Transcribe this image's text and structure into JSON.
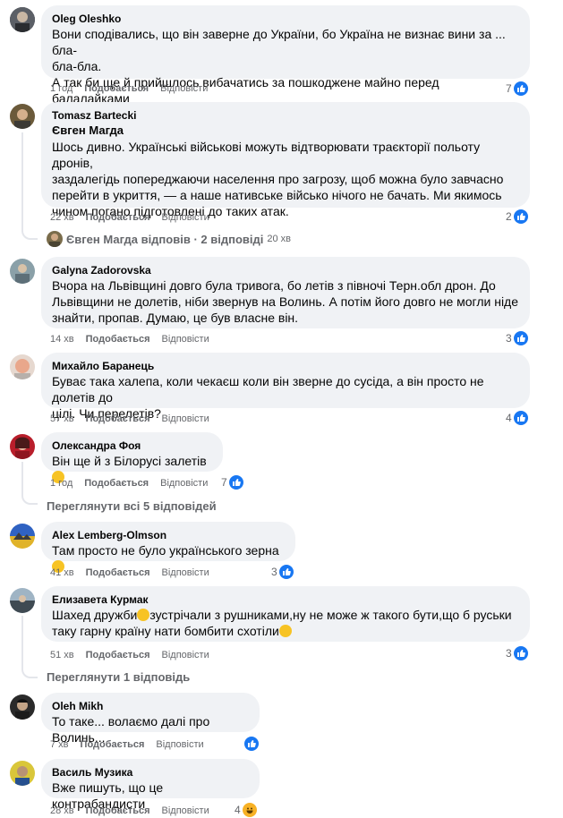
{
  "comments": [
    {
      "author": "Oleg Oleshko",
      "lines": [
        "Вони сподівались, що він заверне до України, бо Україна не визнає вини за ... бла-",
        "бла-бла.",
        "А так би ще й прийшлось вибачатись за пошкоджене майно перед балалайками"
      ],
      "time": "1 год",
      "like": "Подобається",
      "reply": "Відповісти",
      "reactions": "7"
    },
    {
      "author": "Tomasz Bartecki",
      "mention": "Євген Магда",
      "lines": [
        "Шось дивно. Українські військові можуть відтворювати траєкторії польоту дронів,",
        "заздалегідь попереджаючи населення про загрозу, щоб можна було завчасно",
        "перейти в укриття, — а наше нативське військо нічого не бачать. Ми якимось",
        "чином погано підготовлені до таких атак."
      ],
      "time": "22 хв",
      "like": "Подобається",
      "reply": "Відповісти",
      "reactions": "2"
    },
    {
      "author": "Galyna Zadorovska",
      "lines": [
        "Вчора на Львівщині довго була тривога, бо летів з півночі Терн.обл дрон. До",
        "Львівщини не долетів, ніби звернув на Волинь. А потім його довго не могли ніде",
        "знайти, пропав. Думаю, це був власне він."
      ],
      "time": "14 хв",
      "like": "Подобається",
      "reply": "Відповісти",
      "reactions": "3"
    },
    {
      "author": "Михайло Баранець",
      "lines": [
        "Буває така халепа, коли чекаєш коли він зверне до сусіда, а він просто не долетів до",
        "цілі. Чи перелетів?"
      ],
      "time": "57 хв",
      "like": "Подобається",
      "reply": "Відповісти",
      "reactions": "4"
    },
    {
      "author": "Олександра Фоя",
      "lines": [
        "Він ще й з Білорусі залетів"
      ],
      "time": "1 год",
      "like": "Подобається",
      "reply": "Відповісти",
      "reactions": "7"
    },
    {
      "author": "Alex Lemberg-Olmson",
      "lines": [
        "Там просто не було українського зерна"
      ],
      "time": "41 хв",
      "like": "Подобається",
      "reply": "Відповісти",
      "reactions": "3"
    },
    {
      "author": "Елизавета Курмак",
      "lines": [
        "Шахед дружби",
        "зустрічали з рушниками,ну не може ж такого бути,що б руськи",
        "таку гарну країну нати бомбити схотіли"
      ],
      "time": "51 хв",
      "like": "Подобається",
      "reply": "Відповісти",
      "reactions": "3"
    },
    {
      "author": "Oleh Mikh",
      "lines": [
        "То таке... волаємо далі про Волинь..."
      ],
      "time": "7 хв",
      "like": "Подобається",
      "reply": "Відповісти",
      "reactions": ""
    },
    {
      "author": "Василь Музика",
      "lines": [
        "Вже пишуть, що це контрабандисти"
      ],
      "time": "28 хв",
      "like": "Подобається",
      "reply": "Відповісти",
      "reactions": "4"
    }
  ],
  "reply_summary": {
    "name": "Євген Магда відповів",
    "sep": " · ",
    "count": "2 відповіді",
    "time": "20 хв"
  },
  "view_more_1": "Переглянути всі 5 відповідей",
  "view_more_2": "Переглянути 1 відповідь",
  "colors": {
    "like_blue": "#1877f2",
    "bubble": "#f0f2f5",
    "meta": "#65676b",
    "haha": "#f7b125"
  }
}
